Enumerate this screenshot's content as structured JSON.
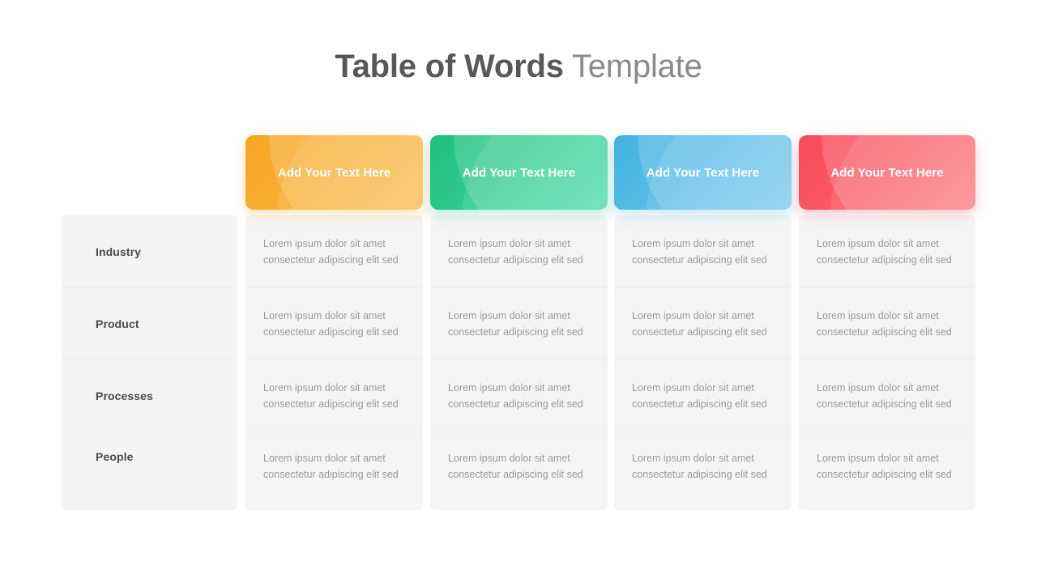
{
  "title": {
    "strong": "Table of Words",
    "light": " Template"
  },
  "colors": {
    "orange": "#F5A623",
    "green": "#21C17F",
    "blue": "#45B3E0",
    "red": "#F84C58",
    "panel_bg": "#F5F5F5",
    "row_divider": "#EAEAEA",
    "title_strong": "#585858",
    "title_light": "#8A8A8A",
    "row_label": "#4A4A4A",
    "cell_text": "#9A9A9A"
  },
  "columns": [
    {
      "header": "Add Your  Text Here",
      "theme": "orange"
    },
    {
      "header": "Add Your  Text Here",
      "theme": "green"
    },
    {
      "header": "Add Your  Text Here",
      "theme": "blue"
    },
    {
      "header": "Add Your  Text Here",
      "theme": "red"
    }
  ],
  "rows": [
    {
      "label": "Industry"
    },
    {
      "label": "Product"
    },
    {
      "label": "Processes"
    },
    {
      "label": "People"
    }
  ],
  "cell_text": "Lorem ipsum dolor sit amet consectetur adipiscing elit sed",
  "cells": [
    [
      "Lorem ipsum dolor sit amet consectetur adipiscing elit sed",
      "Lorem ipsum dolor sit amet consectetur adipiscing elit sed",
      "Lorem ipsum dolor sit amet consectetur adipiscing elit sed",
      "Lorem ipsum dolor sit amet consectetur adipiscing elit sed"
    ],
    [
      "Lorem ipsum dolor sit amet consectetur adipiscing elit sed",
      "Lorem ipsum dolor sit amet consectetur adipiscing elit sed",
      "Lorem ipsum dolor sit amet consectetur adipiscing elit sed",
      "Lorem ipsum dolor sit amet consectetur adipiscing elit sed"
    ],
    [
      "Lorem ipsum dolor sit amet consectetur adipiscing elit sed",
      "Lorem ipsum dolor sit amet consectetur adipiscing elit sed",
      "Lorem ipsum dolor sit amet consectetur adipiscing elit sed",
      "Lorem ipsum dolor sit amet consectetur adipiscing elit sed"
    ],
    [
      "Lorem ipsum dolor sit amet consectetur adipiscing elit sed",
      "Lorem ipsum dolor sit amet consectetur adipiscing elit sed",
      "Lorem ipsum dolor sit amet consectetur adipiscing elit sed",
      "Lorem ipsum dolor sit amet consectetur adipiscing elit sed"
    ]
  ]
}
